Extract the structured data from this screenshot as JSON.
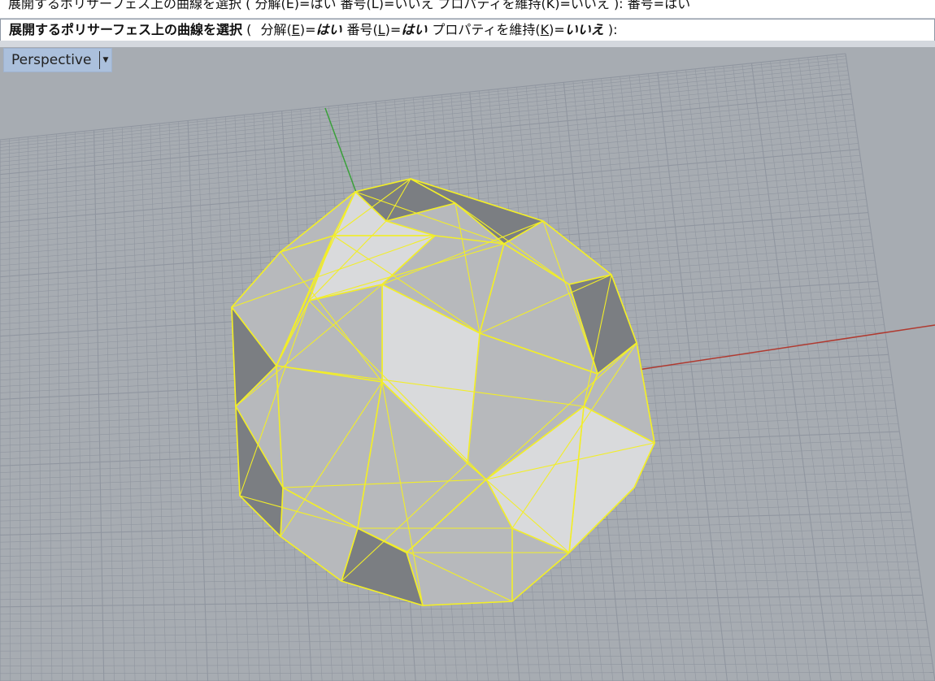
{
  "command_history": {
    "line": "展開するポリサーフェス上の曲線を選択 ( 分解(E)=はい  番号(L)=いいえ  プロパティを維持(K)=いいえ ): 番号=はい"
  },
  "command_prompt": {
    "name": "展開するポリサーフェス上の曲線を選択",
    "open": " ( ",
    "options": [
      {
        "label_pre": "分解(",
        "key": "E",
        "label_post": ")=",
        "value": "はい"
      },
      {
        "label_pre": "番号(",
        "key": "L",
        "label_post": ")=",
        "value": "はい"
      },
      {
        "label_pre": "プロパティを維持(",
        "key": "K",
        "label_post": ")=",
        "value": "いいえ"
      }
    ],
    "close": " ):"
  },
  "viewport": {
    "name": "Perspective",
    "menu_icon": "chevron-down-icon",
    "colors": {
      "background": "#a7acb2",
      "grid": "#9096a0",
      "x_axis": "#b03a30",
      "y_axis": "#3aa03a",
      "selection_wire": "#f2ee28",
      "shade_light": "#d9dadc",
      "shade_mid": "#b7b9bc",
      "shade_dark": "#7b7e82"
    }
  }
}
